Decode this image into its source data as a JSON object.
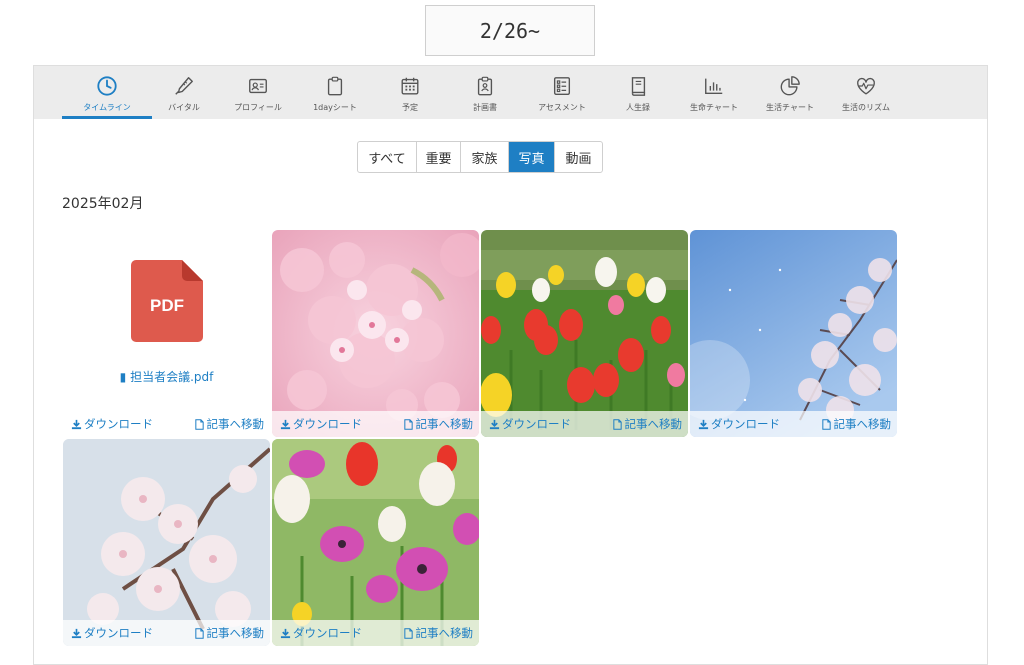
{
  "date_header": "2/26~",
  "tabs": [
    {
      "label": "タイムライン",
      "icon": "clock-icon"
    },
    {
      "label": "バイタル",
      "icon": "thermometer-icon"
    },
    {
      "label": "プロフィール",
      "icon": "id-card-icon"
    },
    {
      "label": "1dayシート",
      "icon": "clipboard-icon"
    },
    {
      "label": "予定",
      "icon": "calendar-icon"
    },
    {
      "label": "計画書",
      "icon": "plan-clipboard-icon"
    },
    {
      "label": "アセスメント",
      "icon": "checklist-icon"
    },
    {
      "label": "人生録",
      "icon": "book-icon"
    },
    {
      "label": "生命チャート",
      "icon": "bar-chart-icon"
    },
    {
      "label": "生活チャート",
      "icon": "pie-chart-icon"
    },
    {
      "label": "生活のリズム",
      "icon": "heartbeat-icon"
    }
  ],
  "active_tab": "タイムライン",
  "filters": [
    "すべて",
    "重要",
    "家族",
    "写真",
    "動画"
  ],
  "active_filter": "写真",
  "month_label": "2025年02月",
  "pdf": {
    "badge": "PDF",
    "filename": "担当者会議.pdf"
  },
  "actions": {
    "download": "ダウンロード",
    "goto": "記事へ移動"
  },
  "photos": [
    {
      "subject": "pink cherry blossoms"
    },
    {
      "subject": "tulip field"
    },
    {
      "subject": "blue sky with cherry branches"
    },
    {
      "subject": "white cherry blossoms"
    },
    {
      "subject": "tulips and anemones"
    }
  ],
  "colors": {
    "accent": "#1e7fc4",
    "pdf": "#de5a4d",
    "tabbar": "#ececec"
  }
}
